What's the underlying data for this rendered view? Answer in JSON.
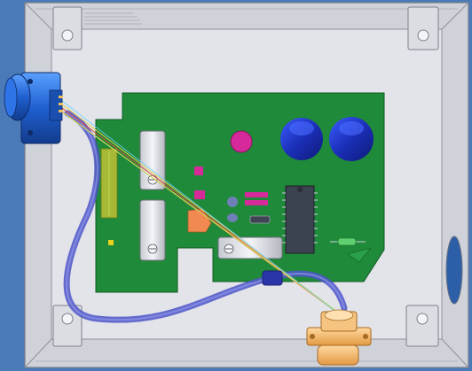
{
  "scene": {
    "background_color": "#4a7ab8",
    "enclosure_color": "#d8d9e0",
    "enclosure_inner_color": "#e4e5ea",
    "pcb_color": "#1f8a3a",
    "cable_color": "#4d56c8",
    "connector_left_color": "#1f5fd0",
    "connector_bottom_color": "#f0b060",
    "capacitor_color": "#1b2fb8",
    "magenta_part_color": "#d62a9b",
    "ic_color": "#3b4250",
    "orange_part_color": "#f08a50",
    "icons": [
      "enclosure-box",
      "pcb-board",
      "left-circular-connector",
      "bottom-circular-connector",
      "blue-electrolytic-capacitor",
      "dip-ic-chip",
      "relay-module",
      "wire-harness"
    ]
  }
}
